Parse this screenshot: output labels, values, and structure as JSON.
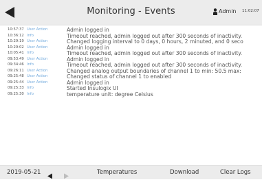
{
  "header": {
    "title": "Monitoring - Events",
    "user": "Admin",
    "time": "11:02:07"
  },
  "events": [
    {
      "time": "10:57:37",
      "level": "User Action",
      "message": "Admin logged in"
    },
    {
      "time": "10:36:12",
      "level": "Info",
      "message": "Timeout reached, admin logged out after 300 seconds of inactivity."
    },
    {
      "time": "10:29:19",
      "level": "User Action",
      "message": "Changed logging interval to 0 days, 0 hours, 2 minuted, and 0 seco"
    },
    {
      "time": "10:29:02",
      "level": "User Action",
      "message": "Admin logged in"
    },
    {
      "time": "10:05:41",
      "level": "Info",
      "message": "Timeout reached, admin logged out after 300 seconds of inactivity."
    },
    {
      "time": "09:53:49",
      "level": "User Action",
      "message": "Admin logged in"
    },
    {
      "time": "09:34:46",
      "level": "Info",
      "message": "Timeout reached, admin logged out after 300 seconds of inactivity."
    },
    {
      "time": "09:26:11",
      "level": "User Action",
      "message": "Changed analog output boundaries of channel 1 to min: 50.5 max:"
    },
    {
      "time": "09:25:48",
      "level": "User Action",
      "message": "Changed status of channel 1 to enabled"
    },
    {
      "time": "09:25:44",
      "level": "User Action",
      "message": "Admin logged in"
    },
    {
      "time": "09:25:33",
      "level": "Info",
      "message": "Started Insulogix UI"
    },
    {
      "time": "09:25:30",
      "level": "Info",
      "message": "temperature unit: degree Celsius"
    }
  ],
  "footer": {
    "date": "2019-05-21",
    "temperatures": "Temperatures",
    "download": "Download",
    "clear_logs": "Clear Logs"
  },
  "colors": {
    "level_text": "#6fa8dc",
    "bar_background": "#ececec"
  }
}
